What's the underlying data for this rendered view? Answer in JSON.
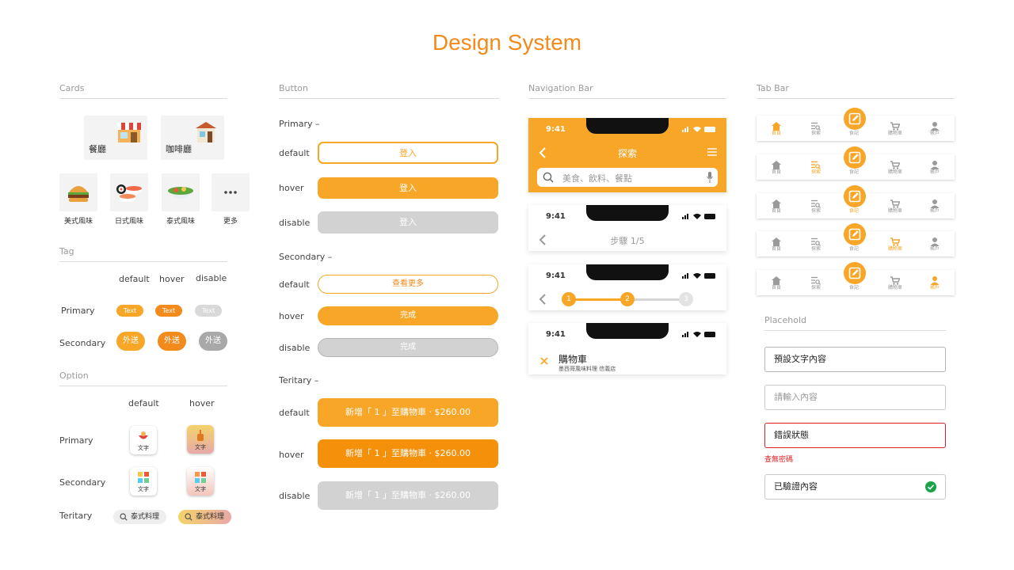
{
  "page": {
    "title": "Design System"
  },
  "colors": {
    "primary": "#f7a627",
    "primary_dark": "#f28a1c",
    "hover": "#f5900a",
    "disabled": "#d2d2d2",
    "error": "#e02020",
    "success": "#1aa34a"
  },
  "cards": {
    "header": "Cards",
    "big": [
      {
        "label": "餐廳",
        "icon": "storefront-icon"
      },
      {
        "label": "咖啡廳",
        "icon": "cafe-shop-icon"
      }
    ],
    "small": [
      {
        "label": "美式風味",
        "icon": "hamburger-icon"
      },
      {
        "label": "日式風味",
        "icon": "sushi-icon"
      },
      {
        "label": "泰式風味",
        "icon": "salad-bowl-icon"
      },
      {
        "label": "更多",
        "icon": "more-dots-icon"
      }
    ]
  },
  "tag": {
    "header": "Tag",
    "states": [
      "default",
      "hover",
      "disable"
    ],
    "rows": [
      "Primary",
      "Secondary"
    ],
    "primary_text": "Text",
    "secondary_text": "外送"
  },
  "option": {
    "header": "Option",
    "states": [
      "default",
      "hover"
    ],
    "rows": [
      "Primary",
      "Secondary",
      "Teritary"
    ],
    "item_text": "文字",
    "pill_text": "泰式料理"
  },
  "button": {
    "header": "Button",
    "groups": [
      {
        "title": "Primary –",
        "label": "登入",
        "states": [
          "default",
          "hover",
          "disable"
        ]
      },
      {
        "title": "Secondary –",
        "labels": [
          "查看更多",
          "完成",
          "完成"
        ],
        "states": [
          "default",
          "hover",
          "disable"
        ]
      },
      {
        "title": "Teritary –",
        "label": "新增「 1 」至購物車 ‧ $260.00",
        "states": [
          "default",
          "hover",
          "disable"
        ]
      }
    ]
  },
  "nav": {
    "header": "Navigation Bar",
    "time": "9:41",
    "explore_title": "探索",
    "search_placeholder": "美食、飲料、餐點",
    "step_title": "步驟 1/5",
    "steps": [
      "1",
      "2",
      "3"
    ],
    "cart_title": "購物車",
    "cart_subtitle": "墨西哥風味料理 信義店"
  },
  "tabbar": {
    "header": "Tab Bar",
    "items": [
      "首頁",
      "探索",
      "食記",
      "購物車",
      "帳戶"
    ],
    "icons": [
      "home-icon",
      "search-list-icon",
      "edit-icon",
      "cart-icon",
      "user-icon"
    ],
    "active": [
      0,
      1,
      2,
      3,
      4
    ]
  },
  "placehold": {
    "header": "Placehold",
    "default_value": "預設文字內容",
    "placeholder": "請輸入內容",
    "error_value": "錯誤狀態",
    "error_msg": "查無密碼",
    "verified_value": "已驗證內容"
  }
}
